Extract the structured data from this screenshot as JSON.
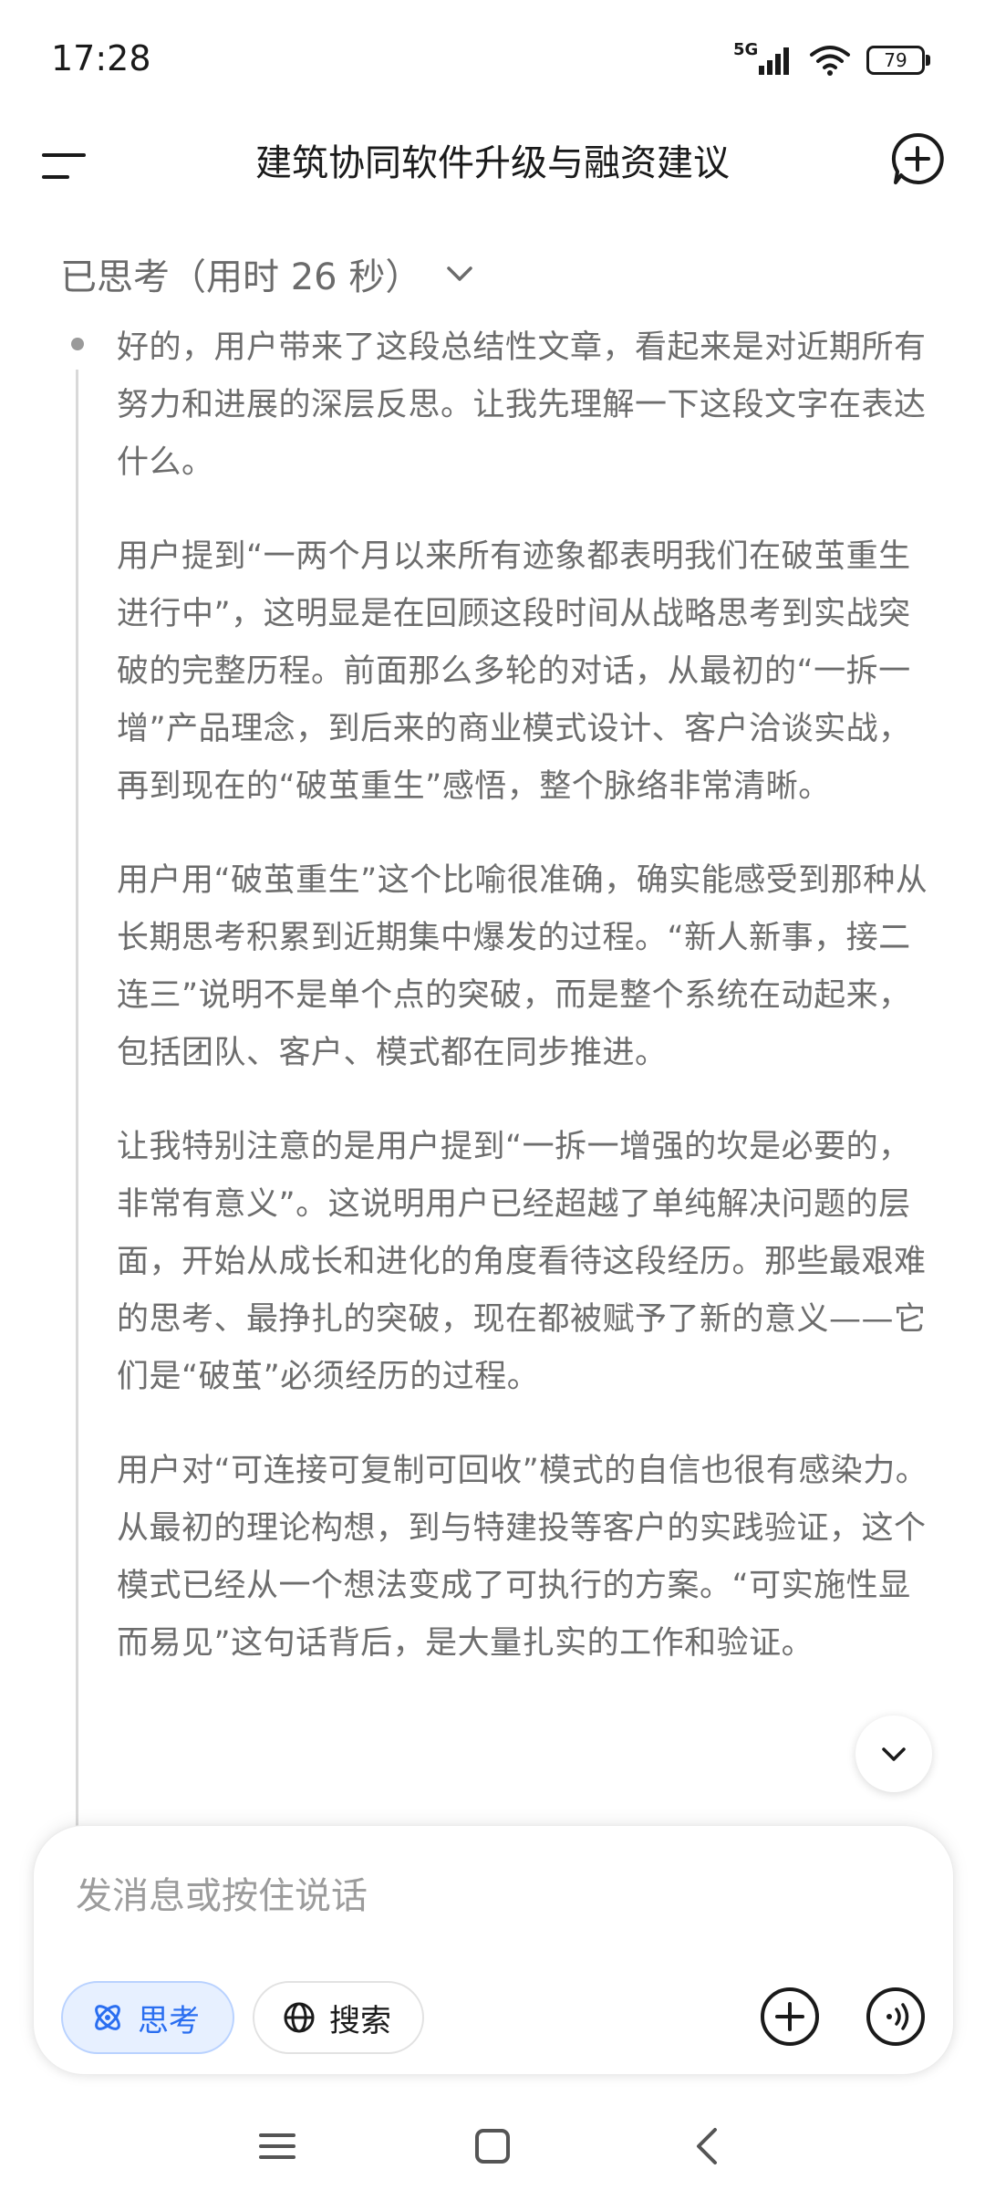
{
  "status": {
    "time": "17:28",
    "network": "5G",
    "battery": "79"
  },
  "header": {
    "title": "建筑协同软件升级与融资建议"
  },
  "thinking": {
    "label": "已思考（用时 26 秒）",
    "paragraphs": [
      "好的，用户带来了这段总结性文章，看起来是对近期所有努力和进展的深层反思。让我先理解一下这段文字在表达什么。",
      "用户提到“一两个月以来所有迹象都表明我们在破茧重生进行中”，这明显是在回顾这段时间从战略思考到实战突破的完整历程。前面那么多轮的对话，从最初的“一拆一增”产品理念，到后来的商业模式设计、客户洽谈实战，再到现在的“破茧重生”感悟，整个脉络非常清晰。",
      "用户用“破茧重生”这个比喻很准确，确实能感受到那种从长期思考积累到近期集中爆发的过程。“新人新事，接二连三”说明不是单个点的突破，而是整个系统在动起来，包括团队、客户、模式都在同步推进。",
      "让我特别注意的是用户提到“一拆一增强的坎是必要的，非常有意义”。这说明用户已经超越了单纯解决问题的层面，开始从成长和进化的角度看待这段经历。那些最艰难的思考、最挣扎的突破，现在都被赋予了新的意义——它们是“破茧”必须经历的过程。",
      "用户对“可连接可复制可回收”模式的自信也很有感染力。从最初的理论构想，到与特建投等客户的实践验证，这个模式已经从一个想法变成了可执行的方案。“可实施性显而易见”这句话背后，是大量扎实的工作和验证。"
    ]
  },
  "composer": {
    "placeholder": "发消息或按住说话",
    "think_label": "思考",
    "search_label": "搜索"
  },
  "colors": {
    "accent": "#2a6ef0",
    "accent_bg": "#e7f0ff",
    "muted_text": "#6d6d6d"
  }
}
